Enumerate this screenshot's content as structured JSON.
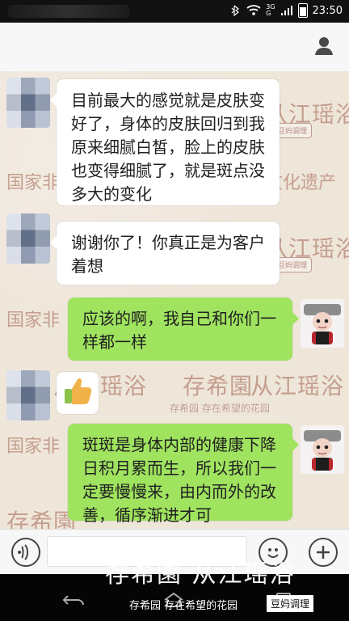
{
  "status_bar": {
    "signal_text": "3G",
    "network_text": "G",
    "time": "23:50"
  },
  "background_watermarks": {
    "brand_cn": "从江瑶浴",
    "brand_stylized": "存希園",
    "heritage_text_left": "国家非",
    "heritage_text_right": "文化遗产",
    "badge_text": "豆妈调理",
    "slogan": "存希园 存在希望的花园"
  },
  "messages": [
    {
      "id": "m1",
      "direction": "in",
      "text": "目前最大的感觉就是皮肤变好了，身体的皮肤回归到我原来细腻白皙，脸上的皮肤也变得细腻了，就是斑点没多大的变化"
    },
    {
      "id": "m2",
      "direction": "in",
      "text": "谢谢你了！你真正是为客户着想"
    },
    {
      "id": "m3",
      "direction": "out",
      "text": "应该的啊，我自己和你们一样都一样"
    },
    {
      "id": "m4",
      "direction": "in",
      "content": "thumbs-up-icon"
    },
    {
      "id": "m5",
      "direction": "out",
      "text": "斑斑是身体内部的健康下降日积月累而生，所以我们一定要慢慢来，由内而外的改善，循序渐进才可"
    }
  ],
  "bottom_overlay": {
    "brand_large": "存希園 从江瑶浴",
    "tagline": "存希园 存在希望的花园",
    "tag": "豆妈调理"
  },
  "icons": {
    "voice_button": "voice-icon",
    "emoji_button": "smile-icon",
    "plus_button": "plus-icon",
    "contact_button": "person-icon",
    "back_button": "back-icon",
    "home_button": "home-icon",
    "recent_button": "recent-apps-icon"
  },
  "colors": {
    "incoming_bubble": "#ffffff",
    "outgoing_bubble": "#9fe35f",
    "topbar": "#f7f7f7",
    "statusbar": "#111111",
    "navbar": "#050505"
  }
}
